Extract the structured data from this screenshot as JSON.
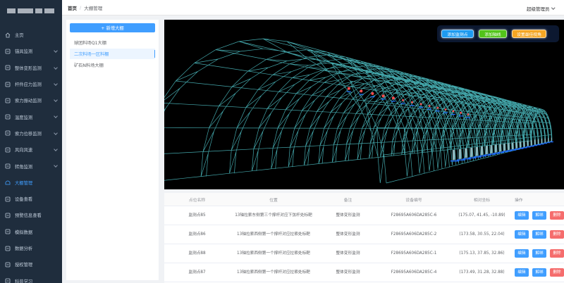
{
  "sidebar": {
    "items": [
      {
        "label": "主页",
        "icon": "home-icon",
        "has_arrow": false,
        "active": false
      },
      {
        "label": "锚具监测",
        "icon": "anchor-icon",
        "has_arrow": true,
        "active": false
      },
      {
        "label": "整体变形监测",
        "icon": "deform-icon",
        "has_arrow": true,
        "active": false
      },
      {
        "label": "杆件应力监测",
        "icon": "stress-icon",
        "has_arrow": true,
        "active": false
      },
      {
        "label": "索力振动监测",
        "icon": "vibration-icon",
        "has_arrow": true,
        "active": false
      },
      {
        "label": "温度监测",
        "icon": "temperature-icon",
        "has_arrow": true,
        "active": false
      },
      {
        "label": "索力位移监测",
        "icon": "displacement-icon",
        "has_arrow": true,
        "active": false
      },
      {
        "label": "风向风速",
        "icon": "wind-icon",
        "has_arrow": true,
        "active": false
      },
      {
        "label": "转角监测",
        "icon": "angle-icon",
        "has_arrow": true,
        "active": false
      },
      {
        "label": "大棚管理",
        "icon": "shed-icon",
        "has_arrow": false,
        "active": true
      },
      {
        "label": "设备查看",
        "icon": "device-icon",
        "has_arrow": false,
        "active": false
      },
      {
        "label": "预警信息查看",
        "icon": "alert-icon",
        "has_arrow": false,
        "active": false
      },
      {
        "label": "模拟数据",
        "icon": "simulate-icon",
        "has_arrow": false,
        "active": false
      },
      {
        "label": "数据分析",
        "icon": "analysis-icon",
        "has_arrow": false,
        "active": false
      },
      {
        "label": "授权管理",
        "icon": "auth-icon",
        "has_arrow": false,
        "active": false
      },
      {
        "label": "科普学习",
        "icon": "learn-icon",
        "has_arrow": false,
        "active": false
      }
    ]
  },
  "header": {
    "breadcrumb_home": "首页",
    "breadcrumb_sep": "/",
    "breadcrumb_current": "大棚管理",
    "user": "超级管理员"
  },
  "left_panel": {
    "add_button": "+ 新增大棚",
    "sheds": [
      {
        "label": "球团料场Q1大棚",
        "selected": false
      },
      {
        "label": "二次料场一区料棚",
        "selected": true
      },
      {
        "label": "矿石N料场大棚",
        "selected": false
      }
    ]
  },
  "viewer": {
    "buttons": [
      {
        "label": "添加监测点",
        "color": "#1e9bf0"
      },
      {
        "label": "添加轴线",
        "color": "#52c41a"
      },
      {
        "label": "设置最佳视角",
        "color": "#f5a623"
      }
    ]
  },
  "table": {
    "headers": [
      "点位名称",
      "位置",
      "备注",
      "设备编号",
      "相对坐标",
      "操作"
    ],
    "rows": [
      {
        "name": "监测点85",
        "location": "13轴拉索东侧第三个撑杆对应下弦杆处标靶",
        "remark": "整体变形监测",
        "device": "F28695A606DA285C-6",
        "coords": "(175.07, 41.45, -10.89)"
      },
      {
        "name": "监测点86",
        "location": "13轴拉索西侧第一个撑杆对应拉索处标靶",
        "remark": "整体变形监测",
        "device": "F28695A606DA285C-2",
        "coords": "(173.58, 30.55, 22.04)"
      },
      {
        "name": "监测点88",
        "location": "13轴拉索西侧第一个撑杆对应拉索处标靶",
        "remark": "整体变形监测",
        "device": "F28695A606DA285C-1",
        "coords": "(175.13, 37.85, 32.86)"
      },
      {
        "name": "监测点87",
        "location": "13轴拉索西侧第一个撑杆对应拉索处标靶",
        "remark": "整体变形监测",
        "device": "F28695A606DA285C-4",
        "coords": "(173.49, 31.28, 32.88)"
      }
    ],
    "actions": {
      "edit": "编辑",
      "bind": "解绑",
      "delete": "删除"
    }
  },
  "colors": {
    "sidebar_bg": "#1f2d3d",
    "accent": "#409eff",
    "danger": "#f56c6c",
    "truss": "#4fc3c8"
  }
}
